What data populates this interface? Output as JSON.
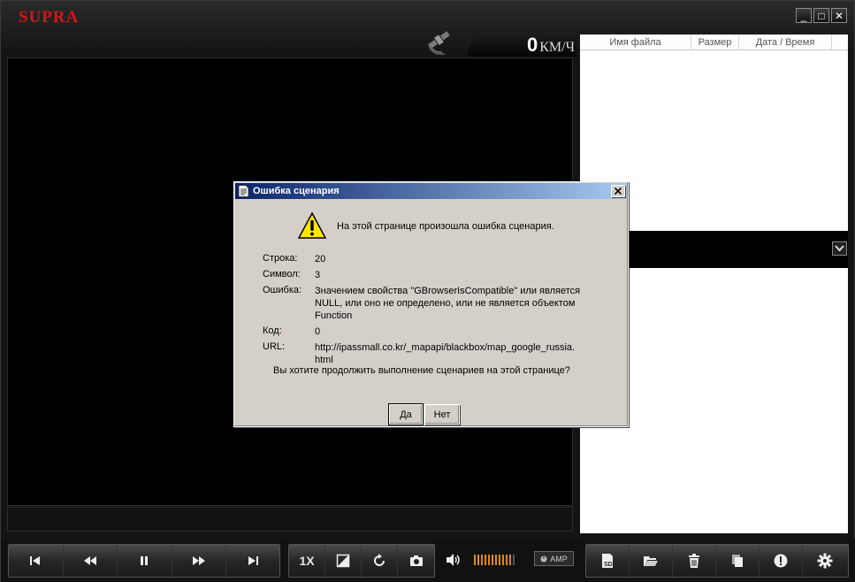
{
  "app": {
    "brand": "SUPRA"
  },
  "window_controls": {
    "minimize": "_",
    "maximize": "□",
    "close": "✕"
  },
  "speed": {
    "value": "0",
    "unit": "КМ/Ч"
  },
  "file_list": {
    "columns": [
      "Имя файла",
      "Размер",
      "Дата / Время"
    ]
  },
  "toolbar": {
    "playback_speed": "1X",
    "amp_label": "AMP",
    "volume_level": 0.9
  },
  "dialog": {
    "title": "Ошибка сценария",
    "message": "На этой странице произошла ошибка сценария.",
    "rows": [
      {
        "label": "Строка:",
        "value": "20"
      },
      {
        "label": "Символ:",
        "value": "3"
      },
      {
        "label": "Ошибка:",
        "value": "Значением свойства \"GBrowserIsCompatible\" или является NULL, или оно не определено, или не является объектом Function"
      },
      {
        "label": "Код:",
        "value": "0"
      },
      {
        "label": "URL:",
        "value": "http://ipassmall.co.kr/_mapapi/blackbox/map_google_russia.html"
      }
    ],
    "question": "Вы хотите продолжить выполнение сценариев на этой странице?",
    "yes_label": "Да",
    "no_label": "Нет"
  },
  "colors": {
    "brand": "#d01818",
    "volume": "#e08a10",
    "title_bar": "#0a246a"
  }
}
